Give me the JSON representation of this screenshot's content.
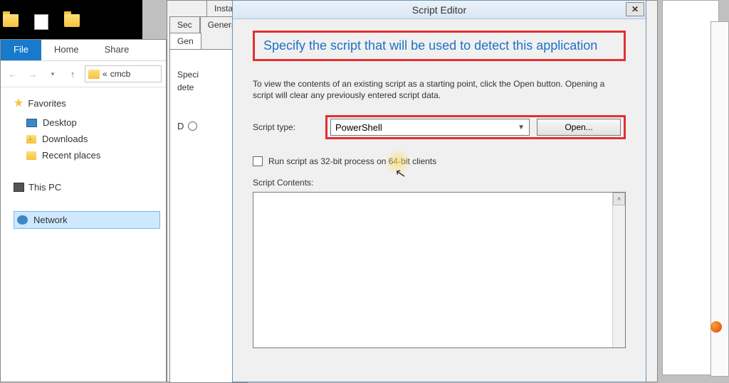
{
  "desktop": {},
  "explorer": {
    "ribbon": {
      "file": "File",
      "home": "Home",
      "share": "Share"
    },
    "breadcrumb_prefix": "«",
    "breadcrumb_text": "cmcb",
    "nav": {
      "favorites": {
        "label": "Favorites"
      },
      "desktop": "Desktop",
      "downloads": "Downloads",
      "recent": "Recent places",
      "thispc": "This PC",
      "network": "Network"
    }
  },
  "prop": {
    "tab_install": "Install",
    "tab_sec": "Sec",
    "tab_genera1": "Genera",
    "tab_genera2": "Gen",
    "spec": "Speci",
    "dete": "dete",
    "d_label": "D"
  },
  "dialog": {
    "title": "Script Editor",
    "heading": "Specify the script that will be used to detect this application",
    "description": "To view the contents of an existing script as a starting point, click the Open button.  Opening a script will clear any previously entered script data.",
    "script_type_label": "Script type:",
    "script_type_value": "PowerShell",
    "open_button": "Open...",
    "checkbox_prefix": "Run script as 32-bit process on ",
    "checkbox_mid": "64-bit",
    "checkbox_suffix": " clients",
    "contents_label": "Script  Contents:"
  }
}
